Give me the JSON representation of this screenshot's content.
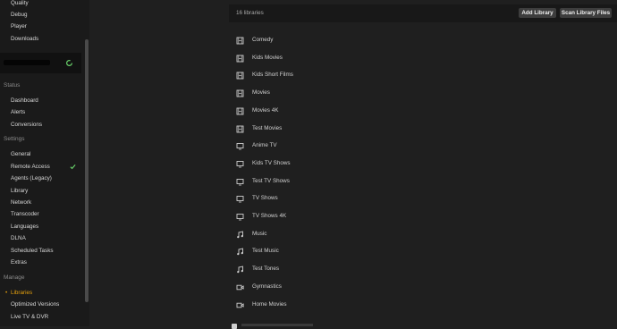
{
  "sidebar": {
    "top_items": [
      "Quality",
      "Debug",
      "Player",
      "Downloads"
    ],
    "server_status_icon": "refresh-icon",
    "sections": {
      "status": {
        "header": "Status",
        "items": [
          "Dashboard",
          "Alerts",
          "Conversions"
        ]
      },
      "settings": {
        "header": "Settings",
        "items": [
          "General",
          "Remote Access",
          "Agents (Legacy)",
          "Library",
          "Network",
          "Transcoder",
          "Languages",
          "DLNA",
          "Scheduled Tasks",
          "Extras"
        ]
      },
      "manage": {
        "header": "Manage",
        "items": [
          "Libraries",
          "Optimized Versions",
          "Live TV & DVR"
        ],
        "active_item": "Libraries"
      }
    },
    "remote_access_status_icon": "check-icon"
  },
  "main": {
    "library_count": "16 libraries",
    "add_library_label": "Add Library",
    "scan_library_label": "Scan Library Files",
    "libraries": [
      {
        "name": "Comedy",
        "icon": "film-icon"
      },
      {
        "name": "Kids Movies",
        "icon": "film-icon"
      },
      {
        "name": "Kids Short Films",
        "icon": "film-icon"
      },
      {
        "name": "Movies",
        "icon": "film-icon"
      },
      {
        "name": "Movies 4K",
        "icon": "film-icon"
      },
      {
        "name": "Test Movies",
        "icon": "film-icon"
      },
      {
        "name": "Anime TV",
        "icon": "tv-icon"
      },
      {
        "name": "Kids TV Shows",
        "icon": "tv-icon"
      },
      {
        "name": "Test TV Shows",
        "icon": "tv-icon"
      },
      {
        "name": "TV Shows",
        "icon": "tv-icon"
      },
      {
        "name": "TV Shows 4K",
        "icon": "tv-icon"
      },
      {
        "name": "Music",
        "icon": "music-icon"
      },
      {
        "name": "Test Music",
        "icon": "music-icon"
      },
      {
        "name": "Test Tones",
        "icon": "music-icon"
      },
      {
        "name": "Gymnastics",
        "icon": "video-icon"
      },
      {
        "name": "Home Movies",
        "icon": "video-icon"
      }
    ]
  },
  "colors": {
    "accent": "#e5a00d",
    "status_ok": "#69d36b",
    "background": "#1f1f1f",
    "sidebar_background": "#1a1a1a"
  }
}
